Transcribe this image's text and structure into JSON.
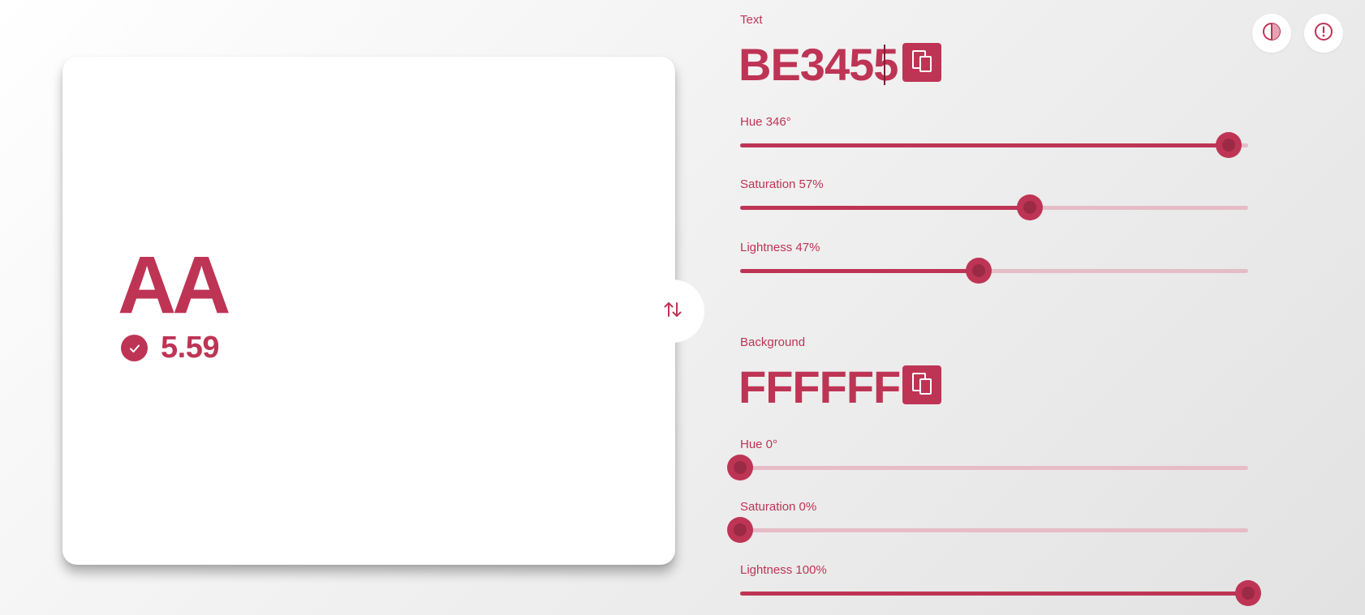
{
  "colors": {
    "accent": "#be3455",
    "background": "#ffffff"
  },
  "preview": {
    "rating": "AA",
    "ratio": "5.59",
    "status_icon": "check-circle-icon"
  },
  "toolbar": {
    "contrast_icon": "contrast-icon",
    "info_icon": "alert-circle-icon",
    "swap_icon": "swap-vertical-icon"
  },
  "text_color": {
    "label": "Text",
    "hex": "BE3455",
    "copy_icon": "copy-icon",
    "sliders": [
      {
        "label": "Hue 346°",
        "value": 346,
        "max": 360
      },
      {
        "label": "Saturation 57%",
        "value": 57,
        "max": 100
      },
      {
        "label": "Lightness 47%",
        "value": 47,
        "max": 100
      }
    ]
  },
  "background_color": {
    "label": "Background",
    "hex": "FFFFFF",
    "copy_icon": "copy-icon",
    "sliders": [
      {
        "label": "Hue 0°",
        "value": 0,
        "max": 360
      },
      {
        "label": "Saturation 0%",
        "value": 0,
        "max": 100
      },
      {
        "label": "Lightness 100%",
        "value": 100,
        "max": 100
      }
    ]
  }
}
